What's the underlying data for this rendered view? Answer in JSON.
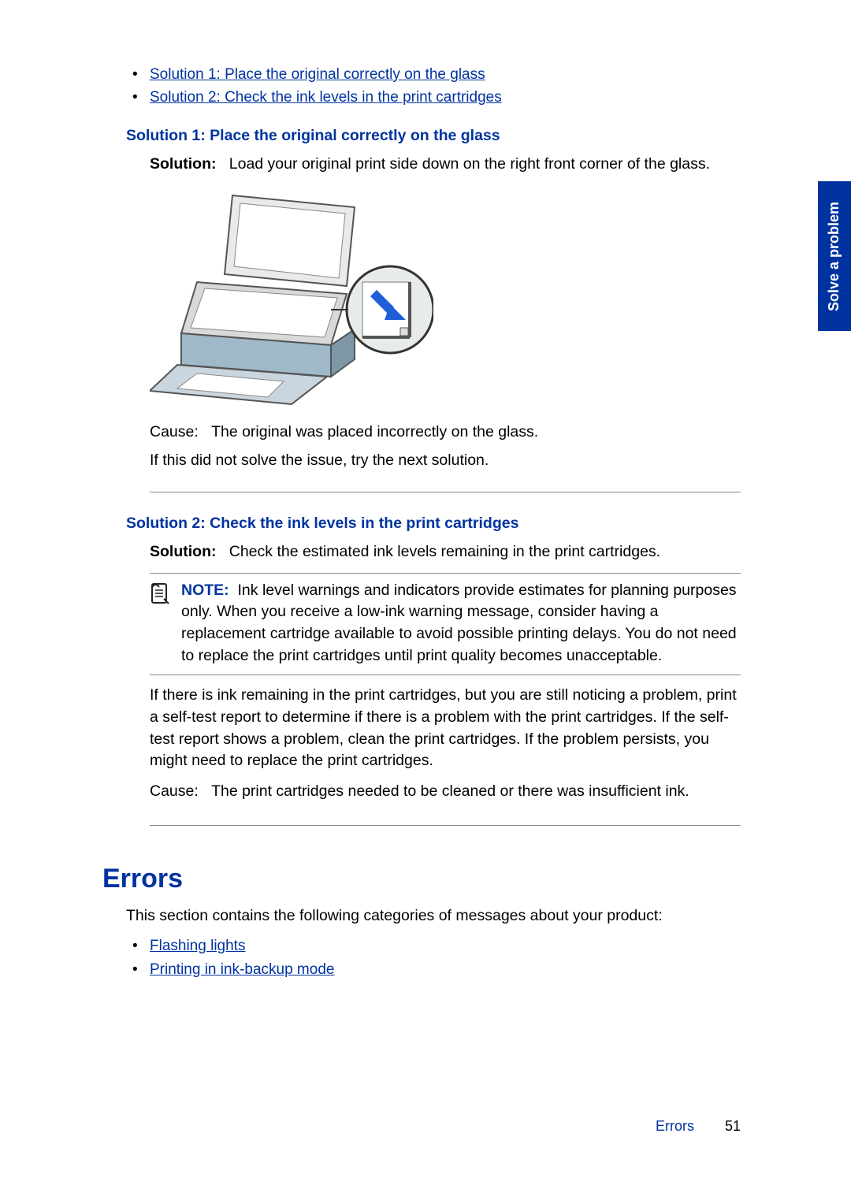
{
  "sideTab": "Solve a problem",
  "topLinks": [
    "Solution 1: Place the original correctly on the glass",
    "Solution 2: Check the ink levels in the print cartridges"
  ],
  "sol1": {
    "heading": "Solution 1: Place the original correctly on the glass",
    "solutionLabel": "Solution:",
    "solutionText": "Load your original print side down on the right front corner of the glass.",
    "causeLabel": "Cause:",
    "causeText": "The original was placed incorrectly on the glass.",
    "followup": "If this did not solve the issue, try the next solution."
  },
  "sol2": {
    "heading": "Solution 2: Check the ink levels in the print cartridges",
    "solutionLabel": "Solution:",
    "solutionText": "Check the estimated ink levels remaining in the print cartridges.",
    "noteLabel": "NOTE:",
    "noteText": "Ink level warnings and indicators provide estimates for planning purposes only. When you receive a low-ink warning message, consider having a replacement cartridge available to avoid possible printing delays. You do not need to replace the print cartridges until print quality becomes unacceptable.",
    "para": "If there is ink remaining in the print cartridges, but you are still noticing a problem, print a self-test report to determine if there is a problem with the print cartridges. If the self-test report shows a problem, clean the print cartridges. If the problem persists, you might need to replace the print cartridges.",
    "causeLabel": "Cause:",
    "causeText": "The print cartridges needed to be cleaned or there was insufficient ink."
  },
  "errors": {
    "heading": "Errors",
    "intro": "This section contains the following categories of messages about your product:",
    "links": [
      "Flashing lights",
      "Printing in ink-backup mode"
    ]
  },
  "footer": {
    "section": "Errors",
    "page": "51"
  }
}
